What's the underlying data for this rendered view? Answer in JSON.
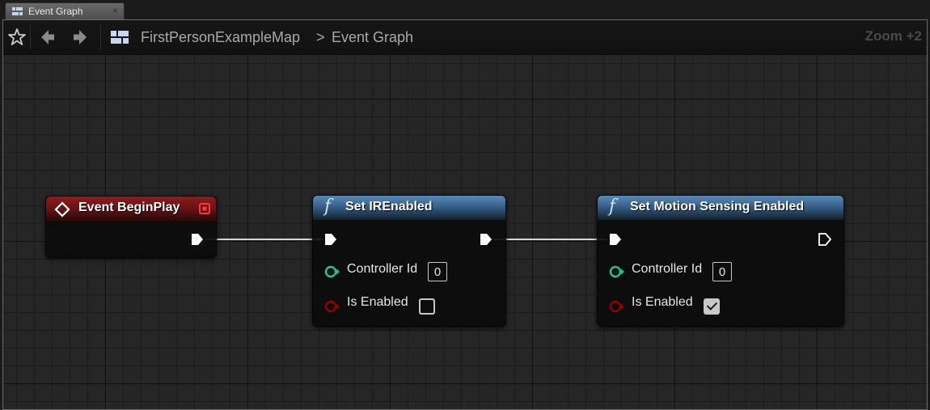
{
  "tab": {
    "label": "Event Graph",
    "close": "×"
  },
  "toolbar": {
    "breadcrumb_root": "FirstPersonExampleMap",
    "breadcrumb_sep": ">",
    "breadcrumb_current": "Event Graph",
    "zoom": "Zoom +2"
  },
  "nodes": {
    "begin_play": {
      "title": "Event BeginPlay"
    },
    "set_ir": {
      "icon": "f",
      "title": "Set IREnabled",
      "controller_label": "Controller Id",
      "controller_value": "0",
      "enabled_label": "Is Enabled",
      "enabled_checked": false
    },
    "set_motion": {
      "icon": "f",
      "title": "Set Motion Sensing Enabled",
      "controller_label": "Controller Id",
      "controller_value": "0",
      "enabled_label": "Is Enabled",
      "enabled_checked": true
    }
  },
  "colors": {
    "event_header": "#8c1d1d",
    "function_header": "#3a6590",
    "int_pin": "#1fc49e",
    "bool_pin": "#950000",
    "exec_pin": "#ffffff"
  }
}
